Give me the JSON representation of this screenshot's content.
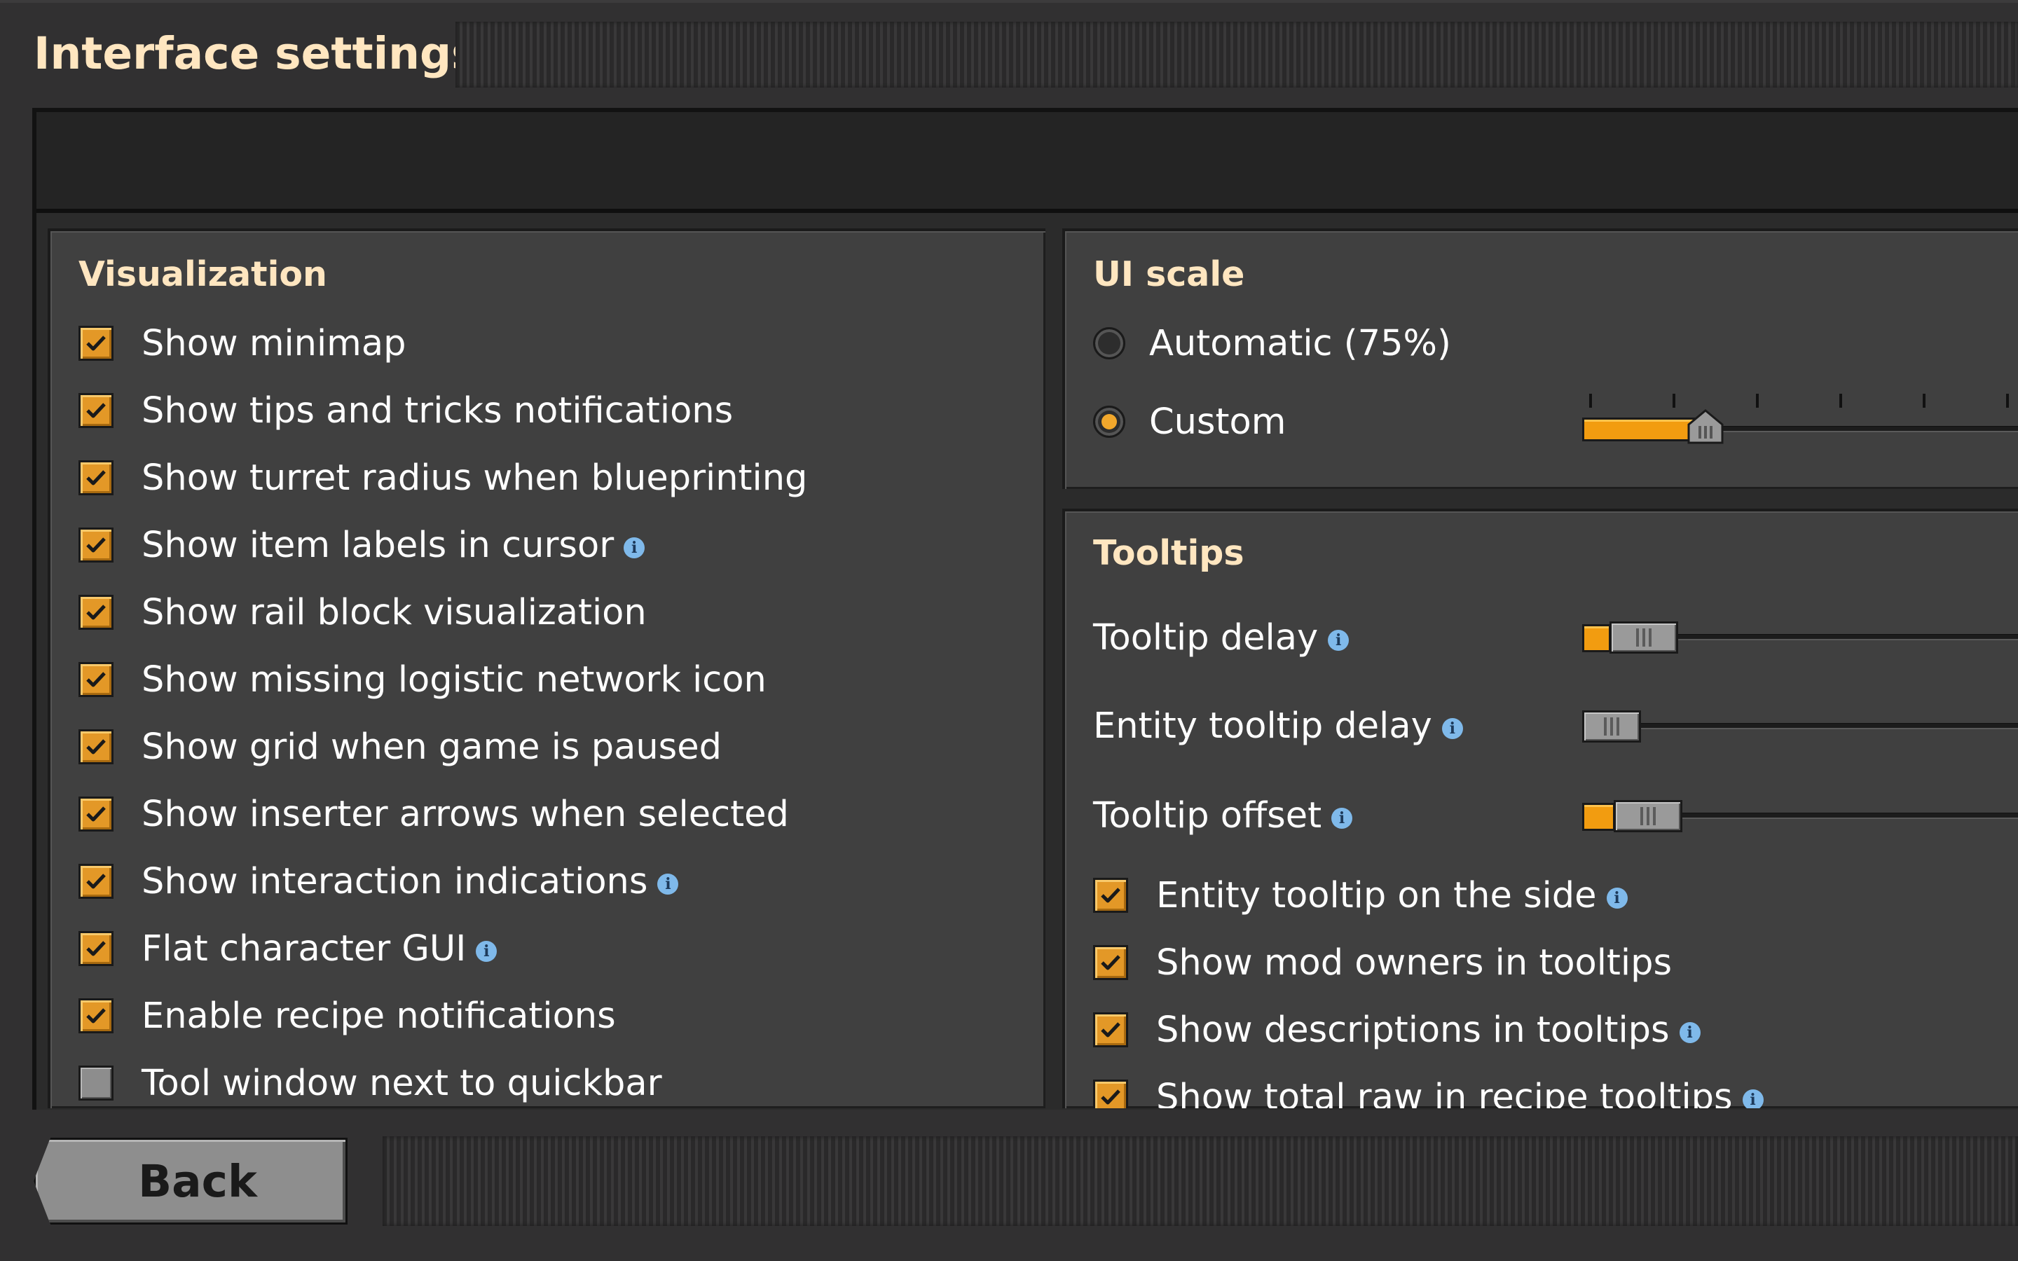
{
  "window": {
    "title": "Interface settings"
  },
  "visualization": {
    "heading": "Visualization",
    "items": [
      {
        "label": "Show minimap",
        "checked": true,
        "info": false
      },
      {
        "label": "Show tips and tricks notifications",
        "checked": true,
        "info": false
      },
      {
        "label": "Show turret radius when blueprinting",
        "checked": true,
        "info": false
      },
      {
        "label": "Show item labels in cursor",
        "checked": true,
        "info": true
      },
      {
        "label": "Show rail block visualization",
        "checked": true,
        "info": false
      },
      {
        "label": "Show missing logistic network icon",
        "checked": true,
        "info": false
      },
      {
        "label": "Show grid when game is paused",
        "checked": true,
        "info": false
      },
      {
        "label": "Show inserter arrows when selected",
        "checked": true,
        "info": false
      },
      {
        "label": "Show interaction indications",
        "checked": true,
        "info": true
      },
      {
        "label": "Flat character GUI",
        "checked": true,
        "info": true
      },
      {
        "label": "Enable recipe notifications",
        "checked": true,
        "info": false
      },
      {
        "label": "Tool window next to quickbar",
        "checked": false,
        "info": false
      }
    ]
  },
  "ui_scale": {
    "heading": "UI scale",
    "options": [
      {
        "label": "Automatic (75%)",
        "selected": false
      },
      {
        "label": "Custom",
        "selected": true
      }
    ],
    "slider_value_fraction": 0.24
  },
  "tooltips": {
    "heading": "Tooltips",
    "sliders": [
      {
        "label": "Tooltip delay",
        "info": true,
        "value_fraction": 0.02
      },
      {
        "label": "Entity tooltip delay",
        "info": true,
        "value_fraction": 0.0
      },
      {
        "label": "Tooltip offset",
        "info": true,
        "value_fraction": 0.03
      }
    ],
    "checkboxes": [
      {
        "label": "Entity tooltip on the side",
        "checked": true,
        "info": true
      },
      {
        "label": "Show mod owners in tooltips",
        "checked": true,
        "info": false
      },
      {
        "label": "Show descriptions in tooltips",
        "checked": true,
        "info": true
      },
      {
        "label": "Show total raw in recipe tooltips",
        "checked": true,
        "info": true
      }
    ]
  },
  "footer": {
    "back_label": "Back"
  },
  "icons": {
    "checkbox_mark": "checkmark-icon",
    "info": "info-icon"
  },
  "colors": {
    "accent": "#f29c10",
    "heading": "#ffe6c0",
    "info": "#7fb9ea"
  }
}
